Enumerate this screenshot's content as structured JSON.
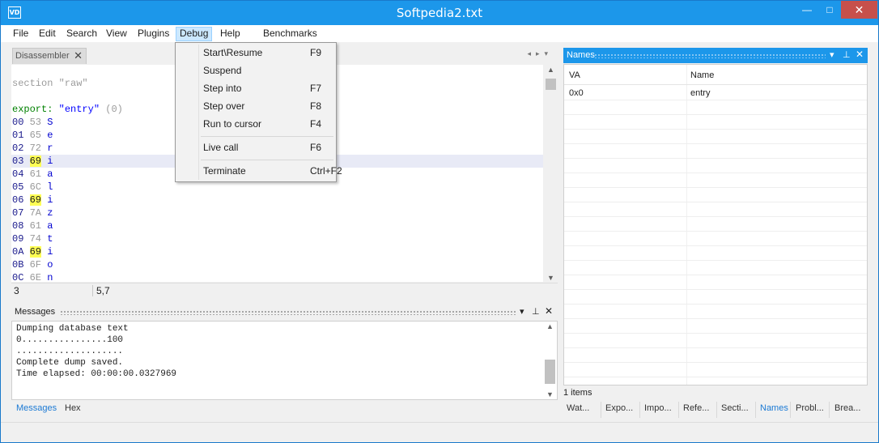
{
  "window": {
    "title": "Softpedia2.txt",
    "app_icon": "VD",
    "minimize_glyph": "—",
    "maximize_glyph": "□",
    "close_glyph": "✕"
  },
  "menubar": {
    "items": [
      "File",
      "Edit",
      "Search",
      "View",
      "Plugins",
      "Debug",
      "Help",
      "Benchmarks"
    ],
    "active": "Debug"
  },
  "debug_menu": {
    "items": [
      {
        "label": "Start\\Resume",
        "shortcut": "F9"
      },
      {
        "label": "Suspend",
        "shortcut": ""
      },
      {
        "label": "Step into",
        "shortcut": "F7"
      },
      {
        "label": "Step over",
        "shortcut": "F8"
      },
      {
        "label": "Run to cursor",
        "shortcut": "F4"
      },
      {
        "label": "Live call",
        "shortcut": "F6"
      },
      {
        "label": "Terminate",
        "shortcut": "Ctrl+F2"
      }
    ]
  },
  "disassembler": {
    "tab_label": "Disassembler",
    "tab_close": "✕",
    "section_line": "section \"raw\"",
    "export_keyword": "export:",
    "export_name": "\"entry\"",
    "export_index": "(0)",
    "rows": [
      {
        "off": "00",
        "hex": "53",
        "chr": "S",
        "hl": false
      },
      {
        "off": "01",
        "hex": "65",
        "chr": "e",
        "hl": false
      },
      {
        "off": "02",
        "hex": "72",
        "chr": "r",
        "hl": false
      },
      {
        "off": "03",
        "hex": "69",
        "chr": "i",
        "hl": true
      },
      {
        "off": "04",
        "hex": "61",
        "chr": "a",
        "hl": false
      },
      {
        "off": "05",
        "hex": "6C",
        "chr": "l",
        "hl": false
      },
      {
        "off": "06",
        "hex": "69",
        "chr": "i",
        "hl": true
      },
      {
        "off": "07",
        "hex": "7A",
        "chr": "z",
        "hl": false
      },
      {
        "off": "08",
        "hex": "61",
        "chr": "a",
        "hl": false
      },
      {
        "off": "09",
        "hex": "74",
        "chr": "t",
        "hl": false
      },
      {
        "off": "0A",
        "hex": "69",
        "chr": "i",
        "hl": true
      },
      {
        "off": "0B",
        "hex": "6F",
        "chr": "o",
        "hl": false
      },
      {
        "off": "0C",
        "hex": "6E",
        "chr": "n",
        "hl": false
      }
    ],
    "status_left": "3",
    "status_right": "5,7"
  },
  "messages": {
    "title": "Messages",
    "lines": [
      "Dumping database text",
      "0................100",
      "....................",
      "Complete dump saved.",
      "Time elapsed: 00:00:00.0327969"
    ],
    "tabs": [
      "Messages",
      "Hex"
    ],
    "active_tab": "Messages"
  },
  "names": {
    "title": "Names",
    "columns": [
      "VA",
      "Name"
    ],
    "rows": [
      {
        "va": "0x0",
        "name": "entry"
      }
    ],
    "footer": "1 items",
    "tabs": [
      "Wat...",
      "Expo...",
      "Impo...",
      "Refe...",
      "Secti...",
      "Names",
      "Probl...",
      "Brea..."
    ],
    "active_tab": "Names"
  }
}
